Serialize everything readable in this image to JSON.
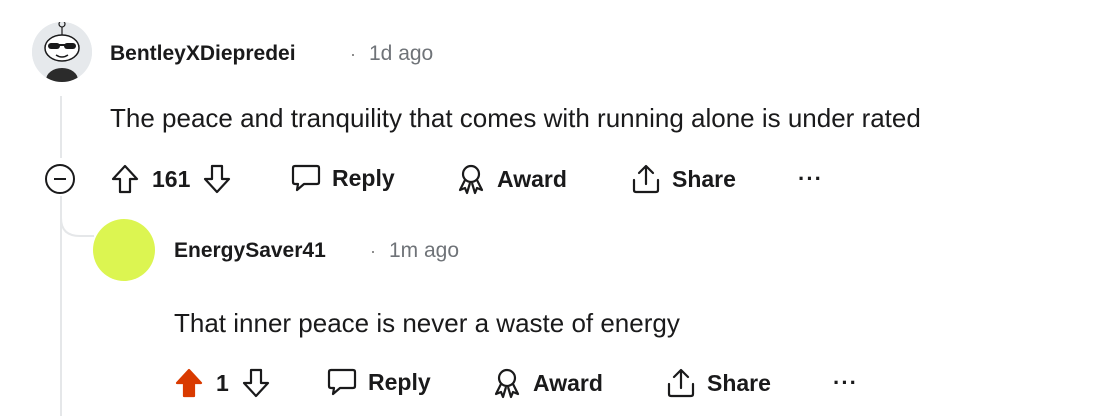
{
  "comment": {
    "username": "BentleyXDiepredei",
    "separator": "·",
    "time": "1d ago",
    "body": "The peace and tranquility that comes with running alone is under rated",
    "votes": "161",
    "reply_label": "Reply",
    "award_label": "Award",
    "share_label": "Share",
    "more_label": "···",
    "upvoted": false
  },
  "reply": {
    "username": "EnergySaver41",
    "separator": "·",
    "time": "1m ago",
    "body": "That inner peace is never a waste of energy",
    "votes": "1",
    "reply_label": "Reply",
    "award_label": "Award",
    "share_label": "Share",
    "more_label": "···",
    "upvoted": true,
    "upvote_color": "#d93a00",
    "avatar_color": "#dcf551"
  }
}
